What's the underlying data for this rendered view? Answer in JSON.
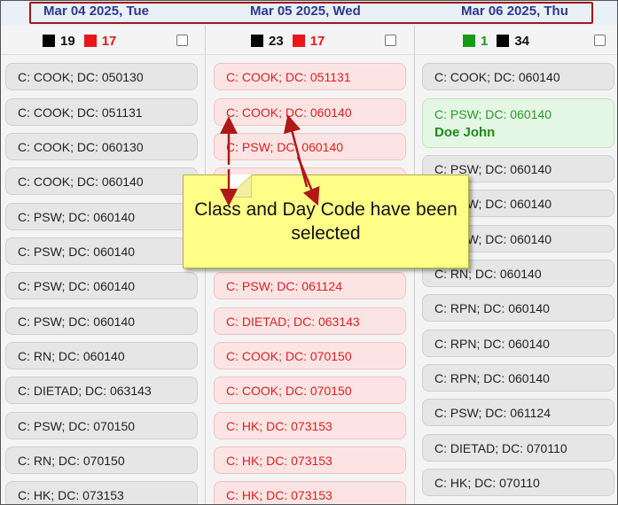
{
  "dates": [
    "Mar 04 2025, Tue",
    "Mar 05 2025, Wed",
    "Mar 06 2025, Thu"
  ],
  "counts": {
    "col1": {
      "black": "19",
      "red": "17"
    },
    "col2": {
      "black": "23",
      "red": "17"
    },
    "col3": {
      "green": "1",
      "black": "34"
    }
  },
  "colors": {
    "black": "#000000",
    "red": "#e8161b",
    "green": "#159a15",
    "arrow": "#b01818"
  },
  "col1": [
    "C: COOK; DC: 050130",
    "C: COOK; DC: 051131",
    "C: COOK; DC: 060130",
    "C: COOK; DC: 060140",
    "C: PSW; DC: 060140",
    "C: PSW; DC: 060140",
    "C: PSW; DC: 060140",
    "C: PSW; DC: 060140",
    "C: RN; DC: 060140",
    "C: DIETAD; DC: 063143",
    "C: PSW; DC: 070150",
    "C: RN; DC: 070150",
    "C: HK; DC: 073153"
  ],
  "col2": [
    "C: COOK; DC: 051131",
    "C: COOK; DC: 060140",
    "C: PSW; DC: 060140",
    "C: PSW; DC: 061124",
    "C: DIETAD; DC: 063143",
    "C: COOK; DC: 070150",
    "C: COOK; DC: 070150",
    "C: HK; DC: 073153",
    "C: HK; DC: 073153",
    "C: HK; DC: 073153"
  ],
  "col3": {
    "assigned": {
      "label": "C: PSW; DC: 060140",
      "name": "Doe John"
    },
    "items": [
      "C: COOK; DC: 060140",
      "C: PSW; DC: 060140",
      "C: PSW; DC: 060140",
      "C: PSW; DC: 060140",
      "C: RN; DC: 060140",
      "C: RPN; DC: 060140",
      "C: RPN; DC: 060140",
      "C: RPN; DC: 060140",
      "C: PSW; DC: 061124",
      "C: DIETAD; DC: 070110",
      "C: HK; DC: 070110"
    ]
  },
  "callout": "Class and Day Code have been selected"
}
